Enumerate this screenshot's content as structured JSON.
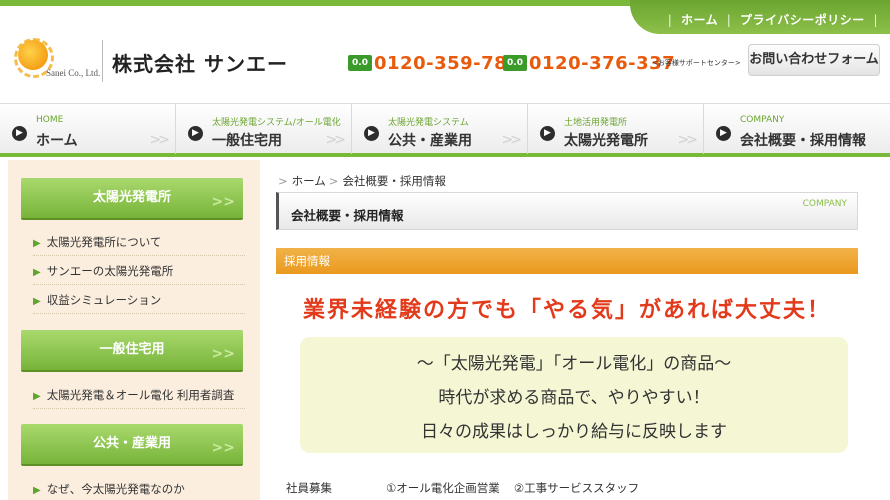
{
  "header": {
    "toplinks": [
      "ホーム",
      "プライバシーポリシー"
    ],
    "logo_text": "Sanei Co., Ltd.",
    "company_name": "株式会社 サンエー",
    "tel_icon": "0.0",
    "phones": [
      "0120-359-788",
      "0120-376-337"
    ],
    "support_label": "<お客様サポートセンター>",
    "contact_button": "お問い合わせフォーム"
  },
  "nav": {
    "items": [
      {
        "sub": "HOME",
        "main": "ホーム"
      },
      {
        "sub": "太陽光発電システム/オール電化",
        "main": "一般住宅用"
      },
      {
        "sub": "太陽光発電システム",
        "main": "公共・産業用"
      },
      {
        "sub": "土地活用発電所",
        "main": "太陽光発電所"
      },
      {
        "sub": "COMPANY",
        "main": "会社概要・採用情報"
      }
    ]
  },
  "sidebar": {
    "sections": [
      {
        "title": "太陽光発電所",
        "links": [
          "太陽光発電所について",
          "サンエーの太陽光発電所",
          "収益シミュレーション"
        ]
      },
      {
        "title": "一般住宅用",
        "links": [
          "太陽光発電＆オール電化 利用者調査"
        ]
      },
      {
        "title": "公共・産業用",
        "links": [
          "なぜ、今太陽光発電なのか"
        ]
      }
    ]
  },
  "main": {
    "breadcrumb": [
      "ホーム",
      "会社概要・採用情報"
    ],
    "page_title": "会社概要・採用情報",
    "page_title_en": "COMPANY",
    "section_title": "採用情報",
    "headline": "業界未経験の方でも「やる気」があれば大丈夫！",
    "message_lines": [
      "～「太陽光発電」「オール電化」の商品～",
      "時代が求める商品で、やりやすい！",
      "日々の成果はしっかり給与に反映します"
    ],
    "job_label": "社員募集",
    "jobs": [
      "①オール電化企画営業",
      "②工事サービススタッフ"
    ]
  },
  "colors": {
    "brand_green": "#7ab83a",
    "accent_orange": "#e99a1e",
    "phone_orange": "#e85a0c",
    "headline_red": "#e23a1a",
    "sidebar_bg": "#fbeede"
  }
}
